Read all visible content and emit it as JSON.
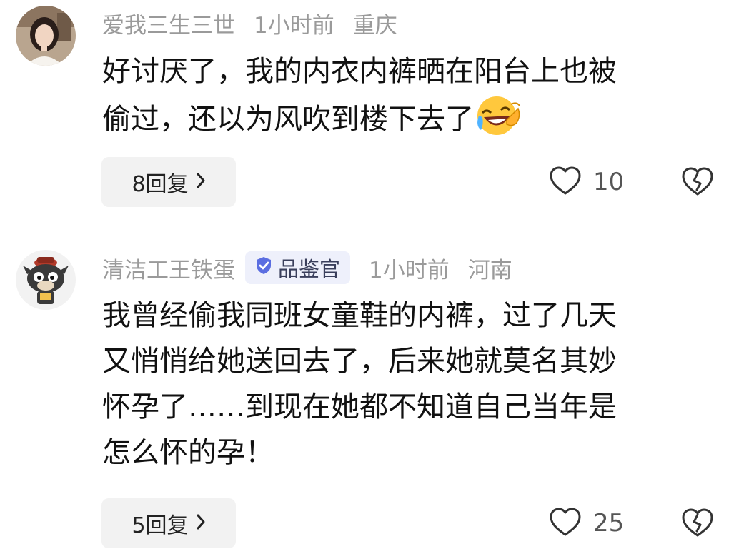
{
  "comments": [
    {
      "username": "爱我三生三世",
      "time": "1小时前",
      "location": "重庆",
      "line1": "好讨厌了，我的内衣内裤晒在阳台上也被",
      "line2": "偷过，还以为风吹到楼下去了",
      "emoji": "laughing-crying-emoji",
      "reply_label": "8回复",
      "likes": "10"
    },
    {
      "username": "清洁工王铁蛋",
      "badge": "品鉴官",
      "time": "1小时前",
      "location": "河南",
      "lines": [
        "我曾经偷我同班女童鞋的内裤，过了几天",
        "又悄悄给她送回去了，后来她就莫名其妙",
        "怀孕了……到现在她都不知道自己当年是",
        "怎么怀的孕！"
      ],
      "reply_label": "5回复",
      "likes": "25"
    }
  ],
  "colors": {
    "meta": "#9a9a9a",
    "badge_bg": "#eef0fb",
    "badge_icon": "#5b6ee1",
    "reply_bg": "#f2f2f2"
  }
}
